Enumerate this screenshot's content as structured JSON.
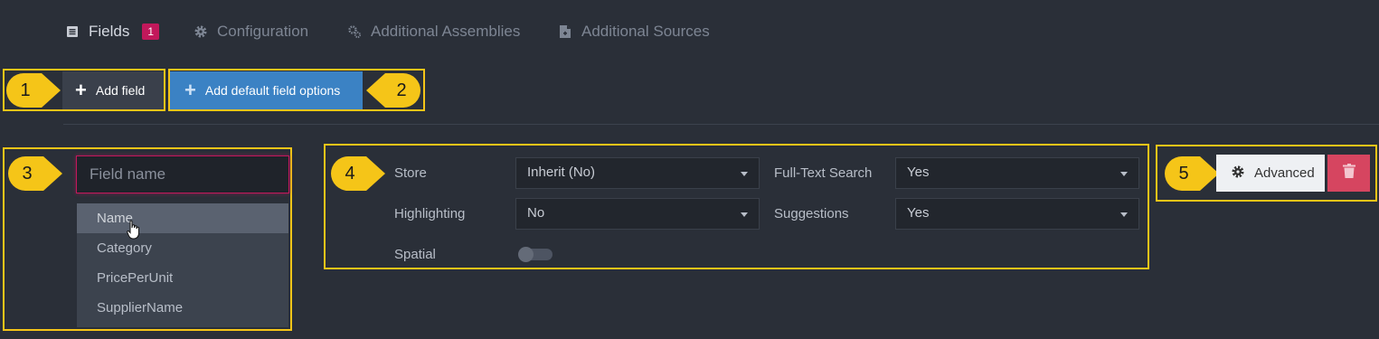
{
  "tabs": [
    {
      "label": "Fields",
      "icon": "list-icon",
      "active": true,
      "badge": "1"
    },
    {
      "label": "Configuration",
      "icon": "gear-icon",
      "active": false
    },
    {
      "label": "Additional Assemblies",
      "icon": "gears-icon",
      "active": false
    },
    {
      "label": "Additional Sources",
      "icon": "file-icon",
      "active": false
    }
  ],
  "callouts": [
    "1",
    "2",
    "3",
    "4",
    "5"
  ],
  "toolbar": {
    "add_field_label": "Add field",
    "add_default_label": "Add default field options"
  },
  "field_name": {
    "placeholder": "Field name",
    "value": "",
    "suggestions": [
      "Name",
      "Category",
      "PricePerUnit",
      "SupplierName"
    ],
    "hovered": "Name"
  },
  "options": {
    "store_label": "Store",
    "store_value": "Inherit (No)",
    "fulltext_label": "Full-Text Search",
    "fulltext_value": "Yes",
    "highlighting_label": "Highlighting",
    "highlighting_value": "No",
    "suggestions_label": "Suggestions",
    "suggestions_value": "Yes",
    "spatial_label": "Spatial",
    "spatial_enabled": false
  },
  "actions": {
    "advanced_label": "Advanced"
  },
  "colors": {
    "background": "#2a2f38",
    "highlight": "#f5c518",
    "primary": "#3b82c4",
    "danger": "#d64560",
    "badge": "#c2185b"
  }
}
